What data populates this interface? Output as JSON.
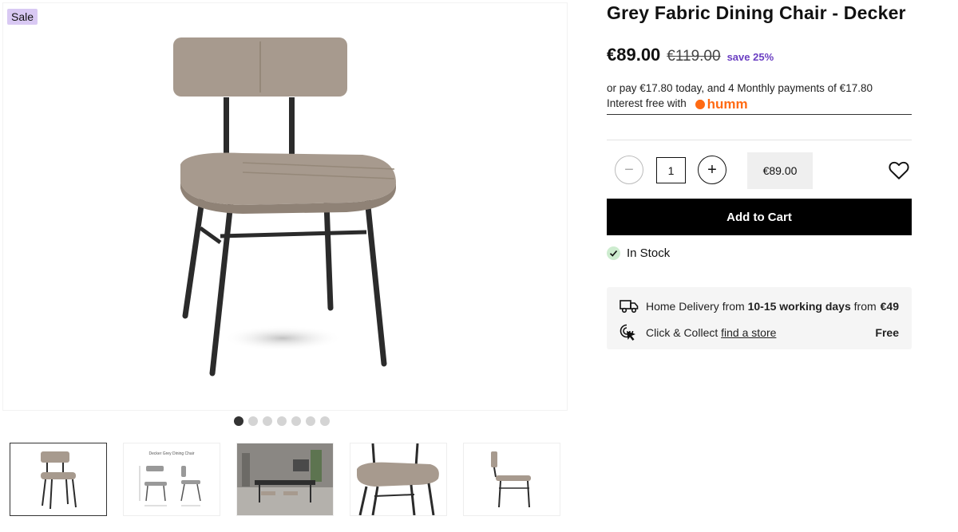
{
  "badge": {
    "sale": "Sale"
  },
  "product": {
    "title": "Grey Fabric Dining Chair - Decker"
  },
  "price": {
    "now": "€89.00",
    "was": "€119.00",
    "save": "save 25%"
  },
  "finance": {
    "line1": "or pay €17.80 today, and 4 Monthly payments of €17.80",
    "line2": "Interest free with",
    "provider": "humm"
  },
  "gallery": {
    "dot_count": 7,
    "active_dot": 0,
    "thumb_caption": "Decker Grey Dining Chair"
  },
  "quantity": {
    "value": "1",
    "minus": "−",
    "plus": "+"
  },
  "line_total": "€89.00",
  "cart": {
    "add_label": "Add to Cart"
  },
  "stock": {
    "label": "In Stock"
  },
  "delivery": {
    "home_prefix": "Home Delivery from",
    "home_days": "10-15 working days",
    "home_suffix": "from",
    "home_price": "€49",
    "collect_prefix": "Click & Collect",
    "collect_link": "find a store",
    "collect_price": "Free"
  },
  "colors": {
    "accent": "#6b3fc2",
    "sale_bg": "#d9c9f3",
    "humm": "#ff6a13",
    "fabric": "#a79a8e",
    "frame": "#2b2b2b"
  },
  "icons": [
    "heart-icon",
    "truck-icon",
    "cursor-click-icon",
    "check-icon",
    "minus-icon",
    "plus-icon"
  ]
}
